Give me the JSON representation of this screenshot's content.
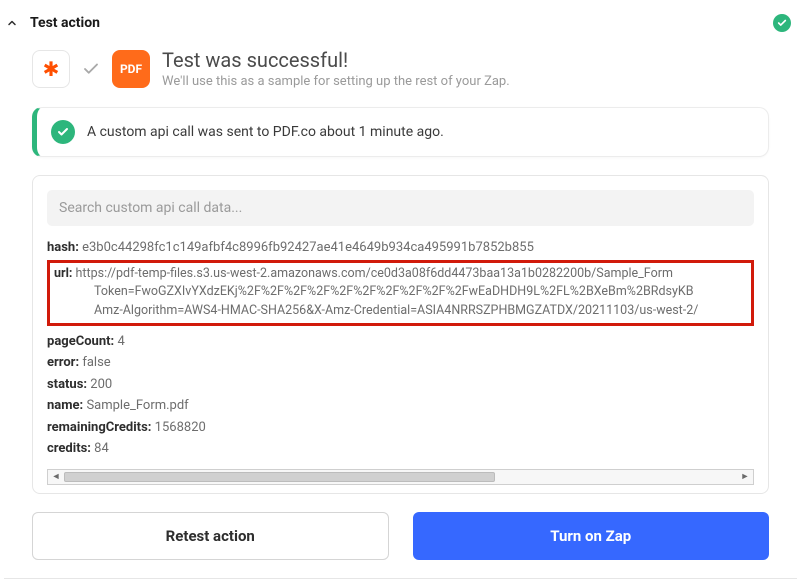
{
  "header": {
    "title": "Test action"
  },
  "success": {
    "title": "Test was successful!",
    "subtitle": "We'll use this as a sample for setting up the rest of your Zap.",
    "pdf_label": "PDF"
  },
  "banner": {
    "text": "A custom api call was sent to PDF.co about 1 minute ago."
  },
  "search": {
    "placeholder": "Search custom api call data..."
  },
  "result": {
    "hash": {
      "key": "hash:",
      "val": "e3b0c44298fc1c149afbf4c8996fb92427ae41e4649b934ca495991b7852b855"
    },
    "url": {
      "key": "url:",
      "line1": "https://pdf-temp-files.s3.us-west-2.amazonaws.com/ce0d3a08f6dd4473baa13a1b0282200b/Sample_Form",
      "line2": "Token=FwoGZXIvYXdzEKj%2F%2F%2F%2F%2F%2F%2F%2F%2F%2FwEaDHDH9L%2FL%2BXeBm%2BRdsyKB",
      "line3": "Amz-Algorithm=AWS4-HMAC-SHA256&X-Amz-Credential=ASIA4NRRSZPHBMGZATDX/20211103/us-west-2/"
    },
    "pageCount": {
      "key": "pageCount:",
      "val": "4"
    },
    "error": {
      "key": "error:",
      "val": "false"
    },
    "status": {
      "key": "status:",
      "val": "200"
    },
    "name": {
      "key": "name:",
      "val": "Sample_Form.pdf"
    },
    "remainingCredits": {
      "key": "remainingCredits:",
      "val": "1568820"
    },
    "credits": {
      "key": "credits:",
      "val": "84"
    }
  },
  "actions": {
    "retest": "Retest action",
    "turn_on": "Turn on Zap"
  }
}
